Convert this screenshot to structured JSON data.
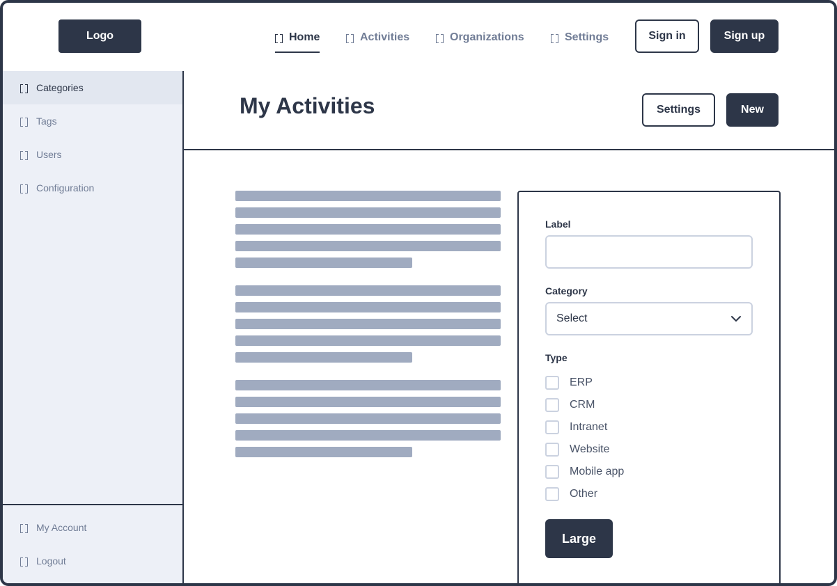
{
  "header": {
    "logo": "Logo",
    "nav": [
      {
        "label": "Home",
        "active": true
      },
      {
        "label": "Activities",
        "active": false
      },
      {
        "label": "Organizations",
        "active": false
      },
      {
        "label": "Settings",
        "active": false
      }
    ],
    "sign_in": "Sign in",
    "sign_up": "Sign up"
  },
  "sidebar": {
    "items": [
      {
        "label": "Categories",
        "active": true
      },
      {
        "label": "Tags"
      },
      {
        "label": "Users"
      },
      {
        "label": "Configuration"
      }
    ],
    "bottom_items": [
      {
        "label": "My Account"
      },
      {
        "label": "Logout"
      }
    ]
  },
  "page": {
    "title": "My Activities",
    "settings_button": "Settings",
    "new_button": "New"
  },
  "form": {
    "label_field": {
      "label": "Label",
      "value": ""
    },
    "category_field": {
      "label": "Category",
      "selected": "Select"
    },
    "type_label": "Type",
    "types": [
      "ERP",
      "CRM",
      "Intranet",
      "Website",
      "Mobile app",
      "Other"
    ],
    "submit": "Large"
  },
  "colors": {
    "primary": "#2d3648",
    "muted_text": "#717d96",
    "sidebar_bg": "#edf0f7",
    "placeholder_bar": "#a0abc0",
    "input_border": "#cbd2e0"
  }
}
